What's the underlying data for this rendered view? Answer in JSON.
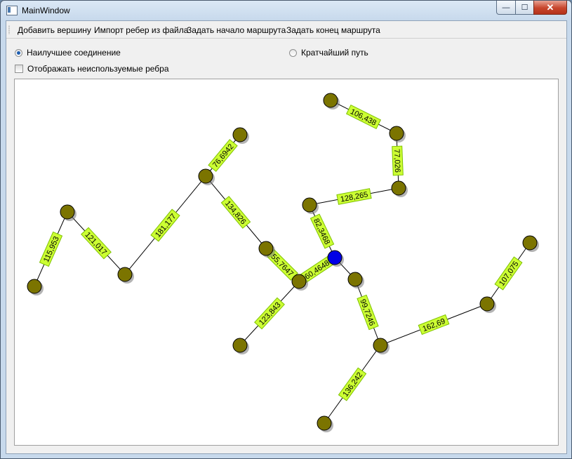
{
  "window": {
    "title": "MainWindow",
    "controls": {
      "minimize": "—",
      "maximize": "☐",
      "close": "✕"
    }
  },
  "menu": {
    "add_vertex": "Добавить вершину",
    "import_edges": "Импорт ребер из файла",
    "set_start": "Задать начало маршрута",
    "set_end": "Задать конец маршрута"
  },
  "options": {
    "best_connection": {
      "label": "Наилучшее соединение",
      "selected": true
    },
    "shortest_path": {
      "label": "Кратчайший путь",
      "selected": false
    },
    "show_unused_edges": {
      "label": "Отображать неиспользуемые ребра",
      "checked": false
    }
  },
  "graph": {
    "colors": {
      "node": "#7b7400",
      "node_start": "#0000e6",
      "edge_label_bg": "#ccff33",
      "edge_label_border": "#7ec000"
    },
    "nodes": [
      {
        "id": "n1",
        "start": false
      },
      {
        "id": "n2",
        "start": false
      },
      {
        "id": "n3",
        "start": false
      },
      {
        "id": "n4",
        "start": false
      },
      {
        "id": "n5",
        "start": false
      },
      {
        "id": "n6",
        "start": false
      },
      {
        "id": "n7",
        "start": false
      },
      {
        "id": "n8",
        "start": false
      },
      {
        "id": "n9",
        "start": false
      },
      {
        "id": "n10",
        "start": false
      },
      {
        "id": "n11",
        "start": false
      },
      {
        "id": "n12",
        "start": true
      },
      {
        "id": "n13",
        "start": false
      },
      {
        "id": "n14",
        "start": false
      },
      {
        "id": "n15",
        "start": false
      },
      {
        "id": "n16",
        "start": false
      },
      {
        "id": "n17",
        "start": false
      },
      {
        "id": "n18",
        "start": false
      },
      {
        "id": "n19",
        "start": false
      }
    ],
    "edges": [
      {
        "from": "n1",
        "to": "n2",
        "label": "115,953"
      },
      {
        "from": "n2",
        "to": "n3",
        "label": "121,017"
      },
      {
        "from": "n3",
        "to": "n4",
        "label": "181,177"
      },
      {
        "from": "n4",
        "to": "n5",
        "label": "76,6942"
      },
      {
        "from": "n4",
        "to": "n6",
        "label": "134,826"
      },
      {
        "from": "n6",
        "to": "n7",
        "label": "55,7647"
      },
      {
        "from": "n7",
        "to": "n8",
        "label": "123,843"
      },
      {
        "from": "n7",
        "to": "n12",
        "label": "60,4648"
      },
      {
        "from": "n12",
        "to": "n11",
        "label": "82,3468"
      },
      {
        "from": "n11",
        "to": "n10",
        "label": "128,265"
      },
      {
        "from": "n10",
        "to": "n9",
        "label": "77,026"
      },
      {
        "from": "n9",
        "to": "n16",
        "label": "106,438"
      },
      {
        "from": "n12",
        "to": "n13",
        "label": ""
      },
      {
        "from": "n13",
        "to": "n14",
        "label": "99,7246"
      },
      {
        "from": "n14",
        "to": "n15",
        "label": "136,242"
      },
      {
        "from": "n14",
        "to": "n17",
        "label": "162,69"
      },
      {
        "from": "n17",
        "to": "n18",
        "label": "107,075"
      }
    ]
  }
}
